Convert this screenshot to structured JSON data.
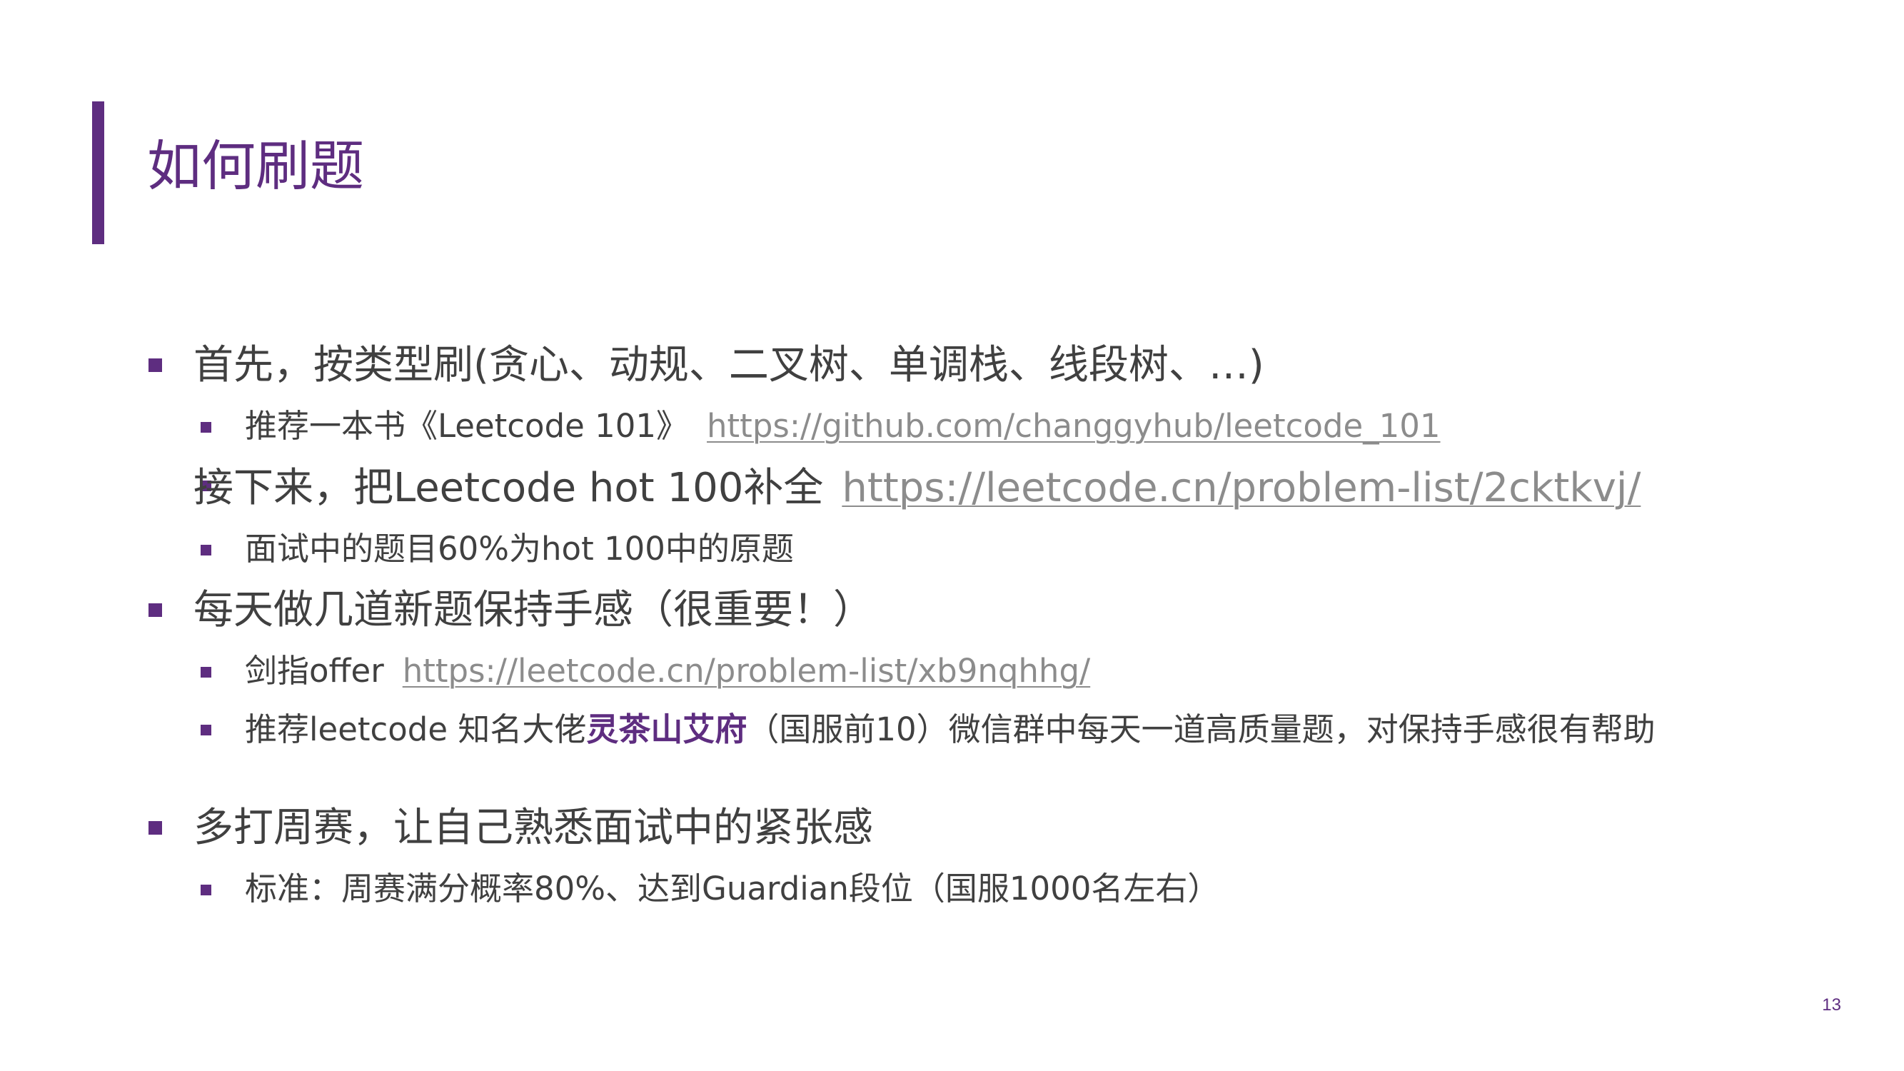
{
  "slide": {
    "title": "如何刷题",
    "page_number": "13",
    "accent_color": "#5e2d80",
    "text_color": "#404040",
    "link_color": "#8c8c8c"
  },
  "items": [
    {
      "level": 1,
      "text": "首先，按类型刷(贪心、动规、二叉树、单调栈、线段树、…)"
    },
    {
      "level": 2,
      "text": "推荐一本书《Leetcode 101》",
      "link": "https://github.com/changgyhub/leetcode_101"
    },
    {
      "level": 1,
      "text": "接下来，把Leetcode hot 100补全",
      "link": "https://leetcode.cn/problem-list/2cktkvj/"
    },
    {
      "level": 2,
      "text": "面试中的题目60%为hot 100中的原题"
    },
    {
      "level": 1,
      "text": "每天做几道新题保持手感（很重要！）"
    },
    {
      "level": 2,
      "text": "剑指offer",
      "link": "https://leetcode.cn/problem-list/xb9nqhhg/"
    },
    {
      "level": 2,
      "text_before": "推荐leetcode 知名大佬",
      "highlight": "灵茶山艾府",
      "text_after": "（国服前10）微信群中每天一道高质量题，对保持手感很有帮助"
    },
    {
      "level": 1,
      "text": "多打周赛，让自己熟悉面试中的紧张感"
    },
    {
      "level": 2,
      "text": "标准：周赛满分概率80%、达到Guardian段位（国服1000名左右）"
    }
  ]
}
